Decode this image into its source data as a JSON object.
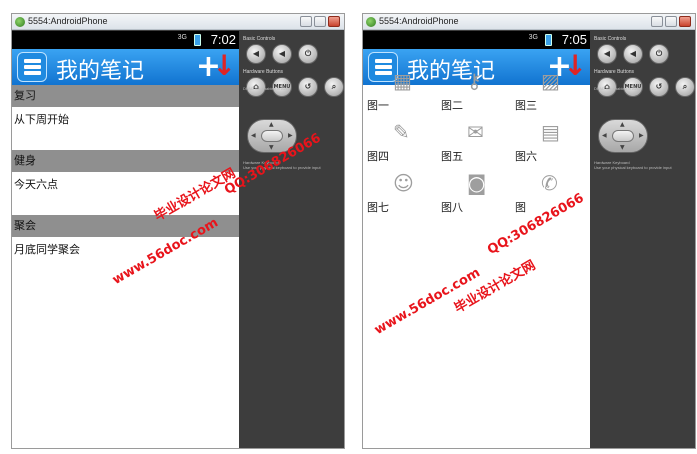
{
  "emulators": [
    {
      "window_title": "5554:AndroidPhone",
      "status": {
        "signal": "3G",
        "time": "7:02"
      },
      "app_title": "我的笔记",
      "categories": [
        {
          "header": "复习",
          "item": "从下周开始"
        },
        {
          "header": "健身",
          "item": "今天六点"
        },
        {
          "header": "聚会",
          "item": "月底同学聚会"
        }
      ]
    },
    {
      "window_title": "5554:AndroidPhone",
      "status": {
        "signal": "3G",
        "time": "7:05"
      },
      "app_title": "我的笔记",
      "grid": [
        {
          "label": "图一",
          "icon": "calendar-icon",
          "glyph": "▦"
        },
        {
          "label": "图二",
          "icon": "key-icon",
          "glyph": "⚷"
        },
        {
          "label": "图三",
          "icon": "picture-icon",
          "glyph": "▨"
        },
        {
          "label": "图四",
          "icon": "pencil-icon",
          "glyph": "✎"
        },
        {
          "label": "图五",
          "icon": "mail-icon",
          "glyph": "✉"
        },
        {
          "label": "图六",
          "icon": "document-icon",
          "glyph": "▤"
        },
        {
          "label": "图七",
          "icon": "contacts-icon",
          "glyph": "☺"
        },
        {
          "label": "图八",
          "icon": "camera-icon",
          "glyph": "◙"
        },
        {
          "label": "图",
          "icon": "phone-icon",
          "glyph": "✆"
        }
      ]
    }
  ],
  "controls": {
    "basic_label": "Basic Controls",
    "hardware_label": "Hardware Buttons",
    "menu_label": "MENU",
    "dpad_note": "DPAD not enabled in AVD",
    "keyboard_title": "Hardware Keyboard",
    "keyboard_note": "Use your physical keyboard to provide input"
  },
  "watermarks": {
    "site": "www.56doc.com",
    "title": "毕业设计论文网",
    "qq": "QQ:306826066"
  },
  "colors": {
    "actionbar": "#1a86e0",
    "category_header": "#8f8f8f",
    "watermark": "#e8141b",
    "down_arrow": "#e02424"
  }
}
